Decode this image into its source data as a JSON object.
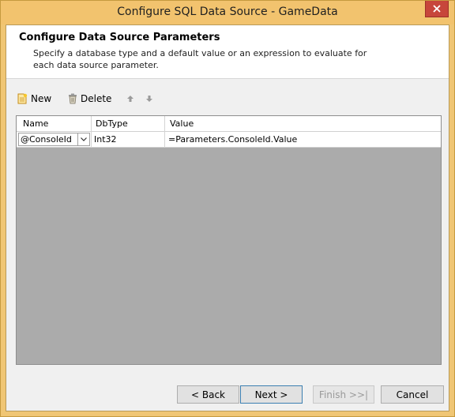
{
  "window": {
    "title": "Configure SQL Data Source - GameData",
    "close_icon": "close-icon"
  },
  "header": {
    "title": "Configure Data Source Parameters",
    "description": "Specify a database type and a default value or an expression to evaluate for each data source parameter."
  },
  "toolbar": {
    "new_label": "New",
    "delete_label": "Delete",
    "icons": [
      "new-document-icon",
      "trash-icon",
      "move-up-arrow-icon",
      "move-down-arrow-icon"
    ]
  },
  "grid": {
    "columns": [
      "Name",
      "DbType",
      "Value"
    ],
    "rows": [
      {
        "name": "@ConsoleId",
        "dbtype": "Int32",
        "value": "=Parameters.ConsoleId.Value"
      }
    ]
  },
  "footer": {
    "back_label": "< Back",
    "next_label": "Next >",
    "finish_label": "Finish >>|",
    "cancel_label": "Cancel"
  },
  "colors": {
    "title_bar": "#f2c36e",
    "close_button": "#c7463b",
    "grid_background": "#ababab"
  }
}
